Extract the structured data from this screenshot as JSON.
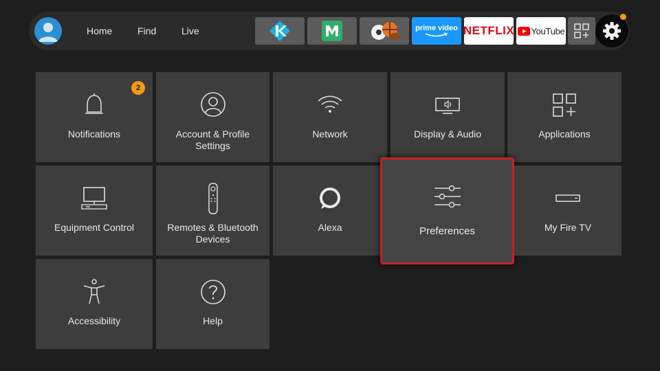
{
  "nav": {
    "links": [
      "Home",
      "Find",
      "Live"
    ],
    "apps": [
      {
        "name": "kodi",
        "icon": "kodi-icon"
      },
      {
        "name": "mobdro",
        "icon": "mobdro-icon"
      },
      {
        "name": "sports",
        "icon": "sports-icon"
      },
      {
        "name": "prime_video",
        "label": "prime video"
      },
      {
        "name": "netflix",
        "label": "NETFLIX"
      },
      {
        "name": "youtube",
        "label": "YouTube"
      },
      {
        "name": "all_apps",
        "icon": "apps-grid-icon"
      }
    ],
    "settings_icon": "gear-icon",
    "colors": {
      "accent": "#f29a12",
      "focus": "#c81f1f"
    }
  },
  "tiles": [
    {
      "label": "Notifications",
      "icon": "bell-icon",
      "badge": "2"
    },
    {
      "label": "Account & Profile Settings",
      "icon": "profile-icon"
    },
    {
      "label": "Network",
      "icon": "wifi-icon"
    },
    {
      "label": "Display & Audio",
      "icon": "display-audio-icon"
    },
    {
      "label": "Applications",
      "icon": "applications-icon"
    },
    {
      "label": "Equipment Control",
      "icon": "equipment-icon"
    },
    {
      "label": "Remotes & Bluetooth Devices",
      "icon": "remote-icon"
    },
    {
      "label": "Alexa",
      "icon": "alexa-icon"
    },
    {
      "label": "Preferences",
      "icon": "sliders-icon",
      "focused": true
    },
    {
      "label": "My Fire TV",
      "icon": "fire-tv-stick-icon"
    },
    {
      "label": "Accessibility",
      "icon": "accessibility-icon"
    },
    {
      "label": "Help",
      "icon": "help-icon"
    }
  ]
}
